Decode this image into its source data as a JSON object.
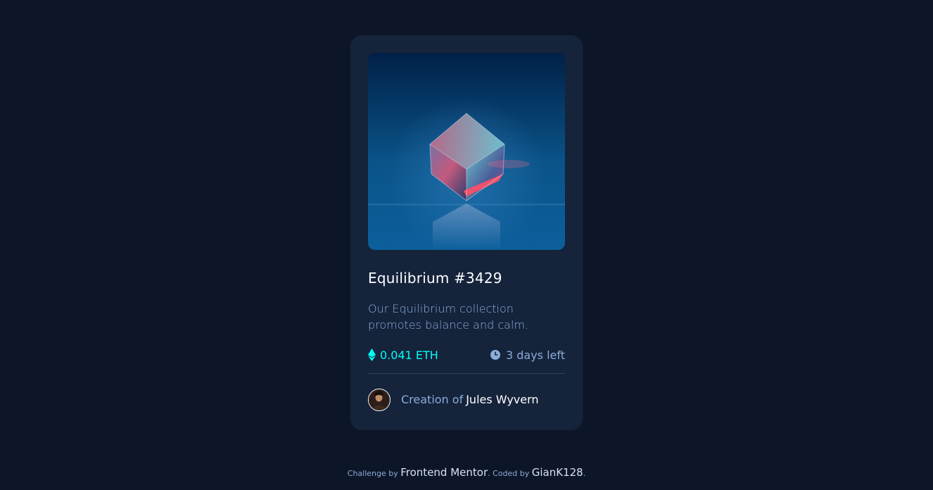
{
  "card": {
    "image": {
      "alt": "Equilibrium",
      "icon": "cube-image"
    },
    "title": "Equilibrium #3429",
    "description": "Our Equilibrium collection promotes balance and calm.",
    "price": {
      "icon": "ethereum-icon",
      "value": "0.041 ETH"
    },
    "time": {
      "icon": "clock-icon",
      "value": "3 days left"
    },
    "creator": {
      "prefix": "Creation of",
      "name": "Jules Wyvern",
      "avatar_icon": "avatar"
    }
  },
  "attribution": {
    "challenge_prefix": "Challenge by",
    "challenge_link": "Frontend Mentor",
    "coded_prefix": ". Coded by",
    "coded_link": "GianK128",
    "suffix": "."
  },
  "colors": {
    "background": "#0d1628",
    "card": "#15233b",
    "accent": "#00fff8",
    "muted": "#8bacda",
    "white": "#ffffff",
    "divider": "#2e405a"
  }
}
